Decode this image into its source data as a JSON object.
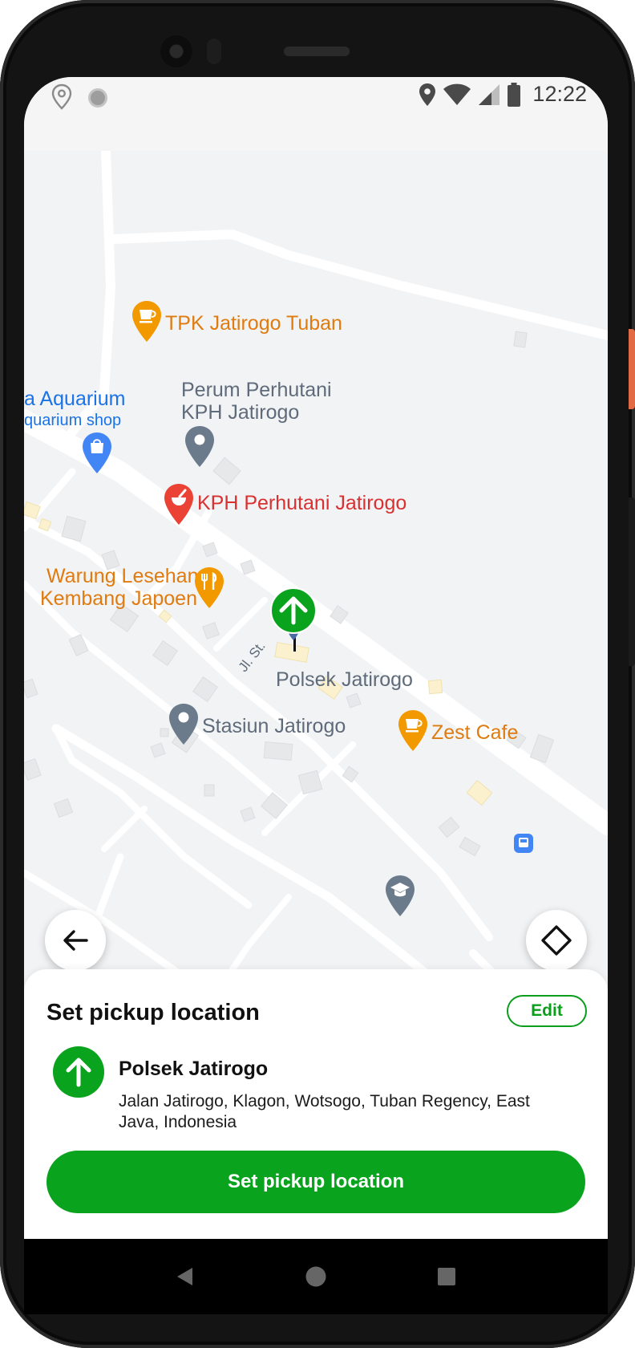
{
  "status_bar": {
    "time": "12:22",
    "left_icons": [
      "location-outline-icon",
      "sync-dot-icon"
    ],
    "right_icons": [
      "location-icon",
      "wifi-icon",
      "signal-icon",
      "battery-icon"
    ]
  },
  "map": {
    "places": [
      {
        "name": "TPK Jatirogo Tuban",
        "icon": "cafe-icon",
        "color": "#f29900"
      },
      {
        "name_line1": "Perum Perhutani",
        "name_line2": "KPH Jatirogo",
        "icon": "place-icon",
        "color": "#6b7b8c"
      },
      {
        "name_line1": "a Aquarium",
        "name_line2": "quarium shop",
        "icon": "shopping-icon",
        "color": "#4285f4"
      },
      {
        "name": "KPH Perhutani Jatirogo",
        "icon": "mortar-pestle-icon",
        "color": "#ea4335"
      },
      {
        "name_line1": "Warung Lesehan",
        "name_line2": "Kembang Japoen",
        "icon": "restaurant-icon",
        "color": "#f29900"
      },
      {
        "name": "Polsek Jatirogo",
        "icon": "pickup-marker-icon",
        "color": "#0aa31e"
      },
      {
        "name": "Stasiun Jatirogo",
        "icon": "place-icon",
        "color": "#6b7b8c"
      },
      {
        "name": "Zest Cafe",
        "icon": "cafe-icon",
        "color": "#f29900"
      },
      {
        "name": "",
        "icon": "school-icon",
        "color": "#6b7b8c"
      },
      {
        "name": "",
        "icon": "bus-icon",
        "color": "#4285f4"
      }
    ],
    "street_label": "Jl. St.",
    "back_button_icon": "arrow-left-icon",
    "directions_button_icon": "directions-icon"
  },
  "sheet": {
    "title": "Set pickup location",
    "edit_label": "Edit",
    "location_name": "Polsek Jatirogo",
    "location_address": "Jalan Jatirogo, Klagon, Wotsogo, Tuban Regency, East Java, Indonesia",
    "primary_button_label": "Set pickup location",
    "accent_color": "#0aa31e"
  },
  "nav_bar": {
    "icons": [
      "back-triangle-icon",
      "home-circle-icon",
      "recents-square-icon"
    ]
  }
}
